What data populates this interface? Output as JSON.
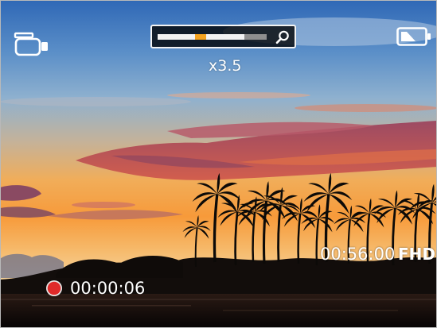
{
  "zoom": {
    "label": "x3.5",
    "level_fraction": 0.34
  },
  "recording": {
    "elapsed": "00:00:06",
    "indicator_color": "#e02a2a"
  },
  "status": {
    "remaining_time": "00:56:00",
    "quality": "FHD"
  },
  "icons": {
    "mode": "video-camera-icon",
    "zoom": "magnifier-icon",
    "battery": "battery-icon"
  },
  "colors": {
    "zoom_accent": "#f4a21e",
    "overlay": "#ffffff"
  }
}
